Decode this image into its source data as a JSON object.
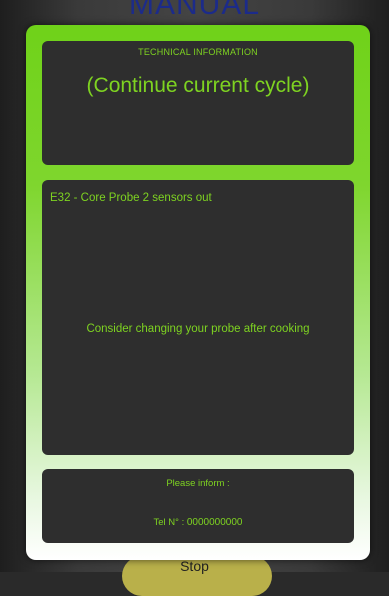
{
  "background": {
    "title": "MANUAL",
    "stop_label": "Stop"
  },
  "modal": {
    "header_label": "TECHNICAL INFORMATION",
    "cycle_message": "(Continue current cycle)",
    "error_code": "E32 - Core Probe 2 sensors out",
    "advice": "Consider changing your probe after cooking",
    "inform_label": "Please inform :",
    "tel_label": "Tel N° :",
    "tel_number": "0000000000"
  },
  "colors": {
    "accent": "#7ed321",
    "panel": "#2e2e2e",
    "background_title": "#1c2b8a"
  }
}
